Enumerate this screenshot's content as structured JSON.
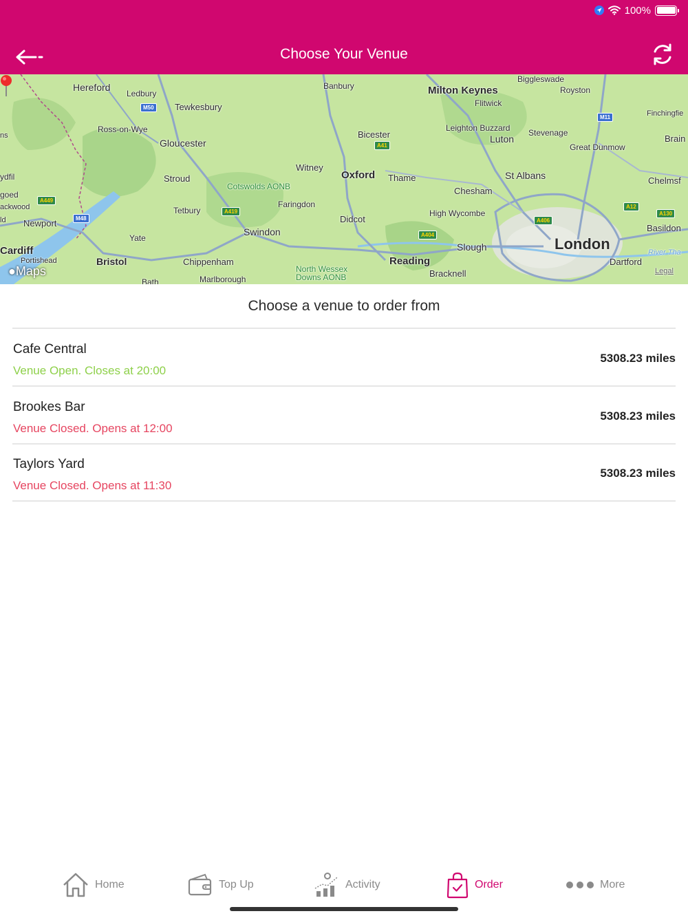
{
  "status_bar": {
    "battery_text": "100%",
    "icons": [
      "location-arrow-icon",
      "wifi-icon",
      "battery-icon"
    ]
  },
  "header": {
    "title": "Choose Your Venue",
    "back_icon": "back-arrow-icon",
    "refresh_icon": "refresh-icon",
    "background_color": "#d0076f"
  },
  "map": {
    "attribution": "Maps",
    "legal": "Legal",
    "labels": [
      "Hereford",
      "Ledbury",
      "Tewkesbury",
      "Ross-on-Wye",
      "Gloucester",
      "Stroud",
      "Tetbury",
      "Cotswolds AONB",
      "Witney",
      "Oxford",
      "Thame",
      "Faringdon",
      "Didcot",
      "Swindon",
      "Chippenham",
      "Marlborough",
      "North Wessex Downs AONB",
      "Reading",
      "Bracknell",
      "Slough",
      "High Wycombe",
      "Chesham",
      "St Albans",
      "London",
      "Dartford",
      "Basildon",
      "Chelmsf",
      "Brain",
      "Great Dunmow",
      "Stevenage",
      "Luton",
      "Leighton Buzzard",
      "Flitwick",
      "Milton Keynes",
      "Royston",
      "Biggleswade",
      "Banbury",
      "Bicester",
      "Finchingfie",
      "Newport",
      "Cardiff",
      "Portishead",
      "Bristol",
      "Yate",
      "Bath",
      "ydfil",
      "goed",
      "ackwood",
      "ns",
      "ld",
      "River Tha"
    ],
    "road_badges": [
      "M50",
      "A449",
      "M48",
      "A419",
      "A41",
      "A404",
      "A406",
      "M11",
      "A12",
      "A130"
    ]
  },
  "content": {
    "heading": "Choose a venue to order from",
    "venues": [
      {
        "name": "Cafe Central",
        "status": "Venue Open. Closes at 20:00",
        "status_type": "open",
        "distance": "5308.23 miles"
      },
      {
        "name": "Brookes Bar",
        "status": "Venue Closed. Opens at 12:00",
        "status_type": "closed",
        "distance": "5308.23 miles"
      },
      {
        "name": "Taylors Yard",
        "status": "Venue Closed. Opens at 11:30",
        "status_type": "closed",
        "distance": "5308.23 miles"
      }
    ],
    "colors": {
      "open": "#8ed04a",
      "closed": "#e64560"
    }
  },
  "tabbar": {
    "tabs": [
      {
        "label": "Home",
        "icon": "home-icon",
        "active": false
      },
      {
        "label": "Top Up",
        "icon": "wallet-icon",
        "active": false
      },
      {
        "label": "Activity",
        "icon": "activity-chart-icon",
        "active": false
      },
      {
        "label": "Order",
        "icon": "shopping-bag-icon",
        "active": true
      },
      {
        "label": "More",
        "icon": "more-dots-icon",
        "active": false
      }
    ],
    "active_color": "#d0076f",
    "inactive_color": "#8a8a8a"
  }
}
